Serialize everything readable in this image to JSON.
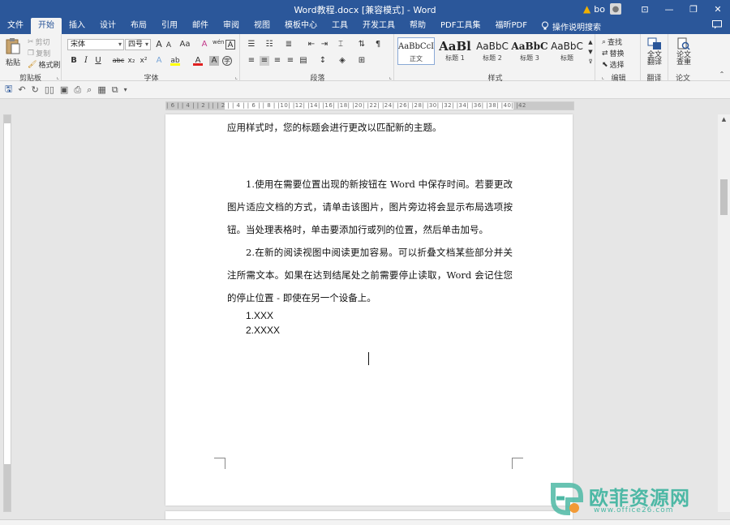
{
  "window": {
    "title": "Word教程.docx [兼容模式] - Word",
    "user": "bo",
    "minimize": "—",
    "restore": "❐",
    "close": "✕",
    "ribbon_display": "⊡"
  },
  "tabs": [
    {
      "label": "文件"
    },
    {
      "label": "开始"
    },
    {
      "label": "插入"
    },
    {
      "label": "设计"
    },
    {
      "label": "布局"
    },
    {
      "label": "引用"
    },
    {
      "label": "邮件"
    },
    {
      "label": "审阅"
    },
    {
      "label": "视图"
    },
    {
      "label": "模板中心"
    },
    {
      "label": "工具"
    },
    {
      "label": "开发工具"
    },
    {
      "label": "帮助"
    },
    {
      "label": "PDF工具集"
    },
    {
      "label": "福昕PDF"
    }
  ],
  "tell_me": "操作说明搜索",
  "ribbon": {
    "clipboard": {
      "paste": "粘贴",
      "cut": "剪切",
      "copy": "复制",
      "format_painter": "格式刷",
      "label": "剪贴板"
    },
    "font": {
      "family": "宋体",
      "size": "四号",
      "grow": "A",
      "shrink": "A",
      "case": "Aa",
      "clear": "A",
      "phonetic": "wén",
      "border": "A",
      "bold": "B",
      "italic": "I",
      "underline": "U",
      "strike": "abc",
      "subscript": "x₂",
      "superscript": "x²",
      "text_effect": "A",
      "highlight": "ab",
      "font_color": "A",
      "char_shading": "A",
      "enclose": "字",
      "label": "字体"
    },
    "paragraph": {
      "label": "段落"
    },
    "styles": {
      "items": [
        {
          "sample": "AaBbCcI",
          "name": "正文"
        },
        {
          "sample": "AaBl",
          "name": "标题 1"
        },
        {
          "sample": "AaBbC",
          "name": "标题 2"
        },
        {
          "sample": "AaBbC",
          "name": "标题 3"
        },
        {
          "sample": "AaBbC",
          "name": "标题"
        }
      ],
      "label": "样式"
    },
    "editing": {
      "find": "查找",
      "replace": "替换",
      "select": "选择",
      "label": "编辑"
    },
    "translate": {
      "button": "全文翻译",
      "label": "翻译"
    },
    "paper": {
      "button": "论文查重",
      "label": "论文"
    }
  },
  "ruler": {
    "marks": "| 6 |  | 4 |  | 2 |  |    | 2 |  | 4 |  | 6 |  | 8 |  |10|  |12|  |14|  |16|  |18|  |20|  |22|  |24|  |26|  |28|  |30|  |32|  |34|  |36|  |38|  |40|  |42"
  },
  "document": {
    "line_top": "应用样式时，您的标题会进行更改以匹配新的主题。",
    "para1": "1.使用在需要位置出现的新按钮在 Word 中保存时间。若要更改图片适应文档的方式，请单击该图片，图片旁边将会显示布局选项按钮。当处理表格时，单击要添加行或列的位置，然后单击加号。",
    "para2": "2.在新的阅读视图中阅读更加容易。可以折叠文档某些部分并关注所需文本。如果在达到结尾处之前需要停止读取，Word 会记住您的停止位置 - 即使在另一个设备上。",
    "list": [
      "1.XXX",
      "2.XXXX"
    ]
  },
  "watermark": {
    "brand": "欧菲资源网",
    "url": "www.office26.com"
  },
  "colors": {
    "titlebar": "#2b579a",
    "ribbon": "#f3f3f3",
    "accent_font_color": "#e02020",
    "watermark": "#4db8a5"
  }
}
